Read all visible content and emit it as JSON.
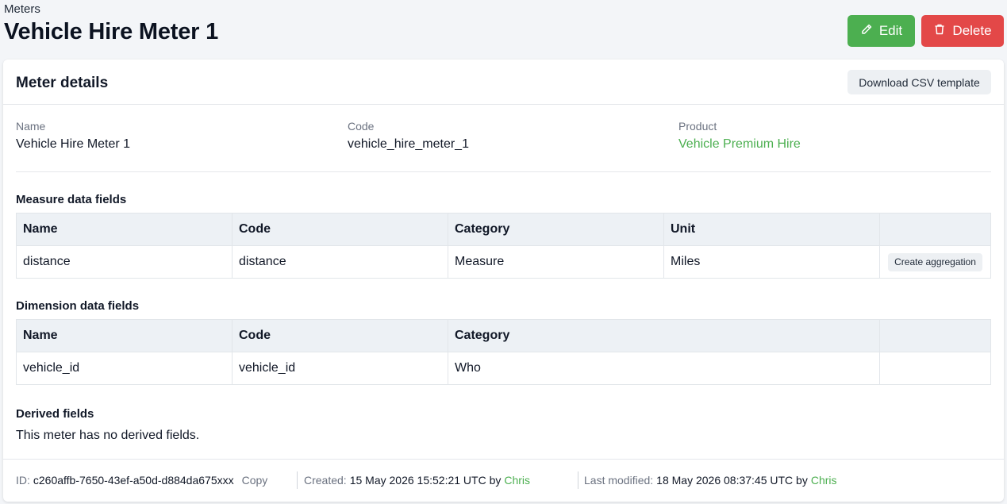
{
  "breadcrumb": "Meters",
  "page_title": "Vehicle Hire Meter 1",
  "actions": {
    "edit_label": "Edit",
    "delete_label": "Delete"
  },
  "card": {
    "title": "Meter details",
    "csv_button": "Download CSV template"
  },
  "details": {
    "name_label": "Name",
    "name_value": "Vehicle Hire Meter 1",
    "code_label": "Code",
    "code_value": "vehicle_hire_meter_1",
    "product_label": "Product",
    "product_value": "Vehicle Premium Hire"
  },
  "measure": {
    "title": "Measure data fields",
    "headers": [
      "Name",
      "Code",
      "Category",
      "Unit"
    ],
    "rows": [
      {
        "name": "distance",
        "code": "distance",
        "category": "Measure",
        "unit": "Miles",
        "action": "Create aggregation"
      }
    ]
  },
  "dimension": {
    "title": "Dimension data fields",
    "headers": [
      "Name",
      "Code",
      "Category"
    ],
    "rows": [
      {
        "name": "vehicle_id",
        "code": "vehicle_id",
        "category": "Who"
      }
    ]
  },
  "derived": {
    "title": "Derived fields",
    "empty_text": "This meter has no derived fields."
  },
  "footer": {
    "id_label": "ID:",
    "id_value": "c260affb-7650-43ef-a50d-d884da675xxx",
    "copy_label": "Copy",
    "created_label": "Created:",
    "created_value": "15 May 2026 15:52:21 UTC by",
    "created_by": "Chris",
    "modified_label": "Last modified:",
    "modified_value": "18 May 2026 08:37:45 UTC by",
    "modified_by": "Chris"
  },
  "colors": {
    "accent": "#4caf50",
    "danger": "#e34848"
  }
}
